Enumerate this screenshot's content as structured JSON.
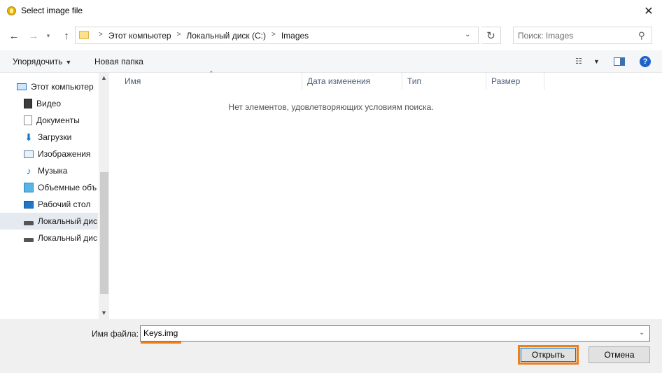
{
  "window": {
    "title": "Select image file"
  },
  "address": {
    "crumbs": [
      "Этот компьютер",
      "Локальный диск (C:)",
      "Images"
    ]
  },
  "search": {
    "placeholder": "Поиск: Images"
  },
  "toolbar": {
    "organize_label": "Упорядочить",
    "new_folder_label": "Новая папка",
    "help_label": "?"
  },
  "nav": {
    "items": [
      {
        "label": "Этот компьютер",
        "icon": "computer-icon"
      },
      {
        "label": "Видео",
        "icon": "video-icon"
      },
      {
        "label": "Документы",
        "icon": "documents-icon"
      },
      {
        "label": "Загрузки",
        "icon": "downloads-icon"
      },
      {
        "label": "Изображения",
        "icon": "pictures-icon"
      },
      {
        "label": "Музыка",
        "icon": "music-icon"
      },
      {
        "label": "Объемные объ",
        "icon": "3d-objects-icon"
      },
      {
        "label": "Рабочий стол",
        "icon": "desktop-icon"
      },
      {
        "label": "Локальный дис",
        "icon": "local-disk-icon",
        "selected": true
      },
      {
        "label": "Локальный дис",
        "icon": "local-disk-icon"
      }
    ]
  },
  "filelist": {
    "columns": [
      "Имя",
      "Дата изменения",
      "Тип",
      "Размер"
    ],
    "empty_message": "Нет элементов, удовлетворяющих условиям поиска."
  },
  "bottom": {
    "filename_label": "Имя файла:",
    "filename_value": "Keys.img",
    "open_label": "Открыть",
    "cancel_label": "Отмена"
  },
  "colors": {
    "highlight": "#f07f1a",
    "accent": "#0078d7",
    "selection": "#e5eaf0"
  }
}
